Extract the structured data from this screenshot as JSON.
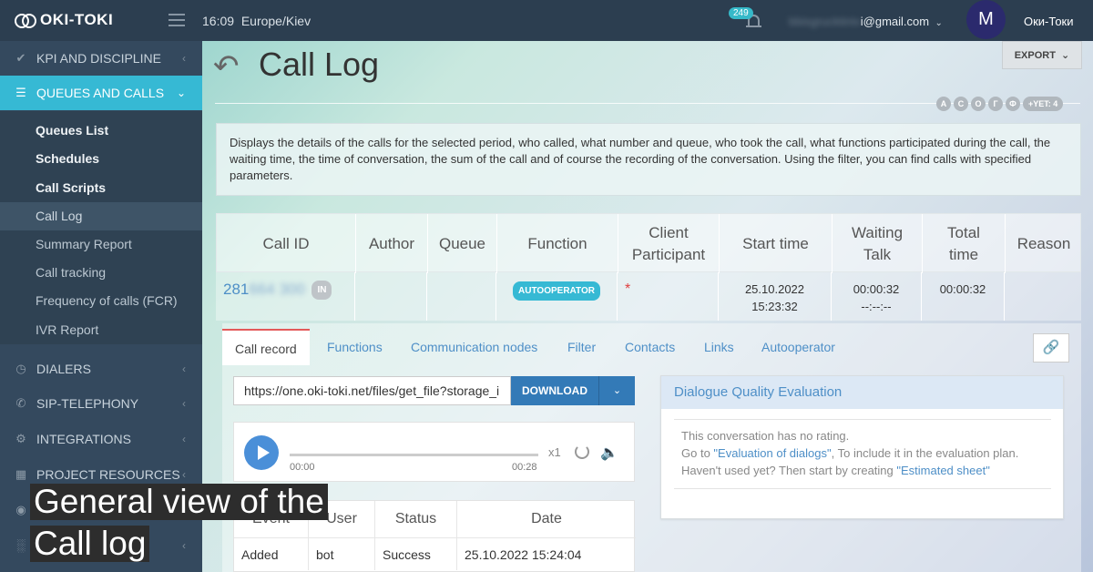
{
  "topbar": {
    "logo": "OKI-TOKI",
    "time": "16:09",
    "timezone": "Europe/Kiev",
    "notif_count": "249",
    "email_hidden": "bbisgrucktiniv",
    "email_visible": "i@gmail.com",
    "avatar_letter": "M",
    "username": "Оки-Токи"
  },
  "sidebar": {
    "items": [
      {
        "label": "KPI AND DISCIPLINE",
        "icon": "check-icon"
      },
      {
        "label": "QUEUES AND CALLS",
        "icon": "list-icon"
      },
      {
        "label": "DIALERS",
        "icon": "clock-icon"
      },
      {
        "label": "SIP-TELEPHONY",
        "icon": "phone-icon"
      },
      {
        "label": "INTEGRATIONS",
        "icon": "gears-icon"
      },
      {
        "label": "PROJECT RESOURCES",
        "icon": "grid-icon"
      }
    ],
    "submenu": [
      {
        "label": "Queues List"
      },
      {
        "label": "Schedules"
      },
      {
        "label": "Call Scripts"
      },
      {
        "label": "Call Log"
      },
      {
        "label": "Summary Report"
      },
      {
        "label": "Call tracking"
      },
      {
        "label": "Frequency of calls (FCR)"
      },
      {
        "label": "IVR Report"
      }
    ]
  },
  "page": {
    "title": "Call Log",
    "export_label": "EXPORT",
    "letters": [
      "А",
      "С",
      "О",
      "Г",
      "Ф"
    ],
    "letters_more": "+YET: 4",
    "description": "Displays the details of the calls for the selected period, who called, what number and queue, who took the call, what functions participated during the call, the waiting time, the time of conversation, the sum of the call and of course the recording of the conversation. Using the filter, you can find calls with specified parameters."
  },
  "table": {
    "headers": {
      "call_id": "Call ID",
      "author": "Author",
      "queue": "Queue",
      "function": "Function",
      "client_1": "Client",
      "client_2": "Participant",
      "start_time": "Start time",
      "waiting_1": "Waiting",
      "waiting_2": "Talk",
      "total_1": "Total",
      "total_2": "time",
      "reason": "Reason"
    },
    "row": {
      "call_id_visible": "281",
      "call_id_hidden": "664 300",
      "direction": "IN",
      "function": "AUTOOPERATOR",
      "client": "*",
      "start_date": "25.10.2022",
      "start_time": "15:23:32",
      "waiting": "00:00:32",
      "talk": "--:--:--",
      "total": "00:00:32"
    }
  },
  "tabs": [
    "Call record",
    "Functions",
    "Communication nodes",
    "Filter",
    "Contacts",
    "Links",
    "Autooperator"
  ],
  "record": {
    "url": "https://one.oki-toki.net/files/get_file?storage_i",
    "download_label": "DOWNLOAD",
    "time_start": "00:00",
    "time_end": "00:28",
    "speed": "x1"
  },
  "log": {
    "headers": [
      "Event",
      "User",
      "Status",
      "Date"
    ],
    "row": [
      "Added",
      "bot",
      "Success",
      "25.10.2022 15:24:04"
    ]
  },
  "dqe": {
    "title": "Dialogue Quality Evaluation",
    "line1": "This conversation has no rating.",
    "line2_pre": "Go to ",
    "line2_link": "\"Evaluation of dialogs\"",
    "line2_post": ", To include it in the evaluation plan.",
    "line3_pre": "Haven't used yet? Then start by creating ",
    "line3_link": "\"Estimated sheet\""
  },
  "caption": {
    "line1": "General view of the",
    "line2": "Call log"
  }
}
